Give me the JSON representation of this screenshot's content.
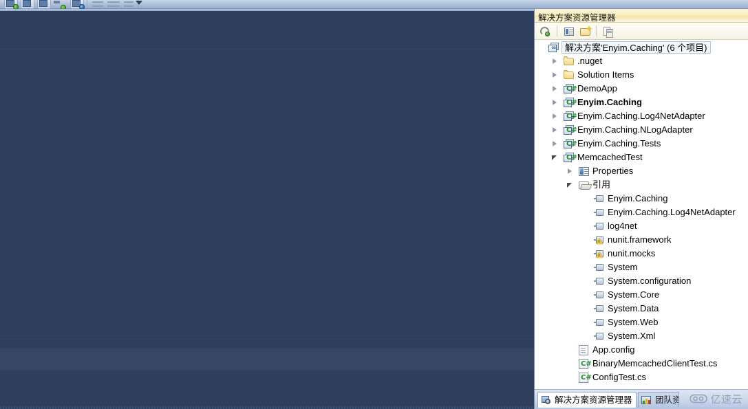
{
  "window": {
    "panel_title": "解决方案资源管理器"
  },
  "vs_toolbar": {
    "buttons": [
      {
        "name": "navigate-backward-button",
        "glyph": "back-arrow-icon"
      },
      {
        "name": "properties-window-button",
        "glyph": "properties-icon"
      },
      {
        "name": "object-browser-button",
        "glyph": "object-browser-icon"
      },
      {
        "name": "navigate-forward-button",
        "glyph": "forward-arrow-icon"
      },
      {
        "name": "toolbox-button",
        "glyph": "toolbox-icon"
      }
    ],
    "overflow_label": "▾"
  },
  "panel_toolbar": {
    "buttons": [
      {
        "name": "refresh-button",
        "icon": "refresh-icon",
        "tooltip": "刷新"
      },
      {
        "name": "properties-button",
        "icon": "properties-icon",
        "tooltip": "属性"
      },
      {
        "name": "show-all-files-button",
        "icon": "show-all-files-icon",
        "tooltip": "显示所有文件"
      },
      {
        "name": "copy-button",
        "icon": "copy-icon",
        "tooltip": "复制"
      }
    ]
  },
  "tree": {
    "nodes": [
      {
        "id": "solution-root",
        "label": "解决方案'Enyim.Caching' (6 个项目)",
        "icon": "solution-icon",
        "indent": 0,
        "twisty": "none",
        "selected": true,
        "bold": false
      },
      {
        "id": "nuget-folder",
        "label": ".nuget",
        "icon": "folder-icon",
        "indent": 1,
        "twisty": "collapsed",
        "selected": false,
        "bold": false
      },
      {
        "id": "solution-items-folder",
        "label": "Solution Items",
        "icon": "folder-icon",
        "indent": 1,
        "twisty": "collapsed",
        "selected": false,
        "bold": false
      },
      {
        "id": "project-demoapp",
        "label": "DemoApp",
        "icon": "csharp-project-icon",
        "indent": 1,
        "twisty": "collapsed",
        "selected": false,
        "bold": false
      },
      {
        "id": "project-enyim-caching",
        "label": "Enyim.Caching",
        "icon": "csharp-project-icon",
        "indent": 1,
        "twisty": "collapsed",
        "selected": false,
        "bold": true
      },
      {
        "id": "project-log4net-adapter",
        "label": "Enyim.Caching.Log4NetAdapter",
        "icon": "csharp-project-icon",
        "indent": 1,
        "twisty": "collapsed",
        "selected": false,
        "bold": false
      },
      {
        "id": "project-nlog-adapter",
        "label": "Enyim.Caching.NLogAdapter",
        "icon": "csharp-project-icon",
        "indent": 1,
        "twisty": "collapsed",
        "selected": false,
        "bold": false
      },
      {
        "id": "project-tests",
        "label": "Enyim.Caching.Tests",
        "icon": "csharp-project-icon",
        "indent": 1,
        "twisty": "collapsed",
        "selected": false,
        "bold": false
      },
      {
        "id": "project-memcachedtest",
        "label": "MemcachedTest",
        "icon": "csharp-project-icon",
        "indent": 1,
        "twisty": "expanded",
        "selected": false,
        "bold": false
      },
      {
        "id": "node-properties",
        "label": "Properties",
        "icon": "properties-node-icon",
        "indent": 2,
        "twisty": "collapsed",
        "selected": false,
        "bold": false
      },
      {
        "id": "node-references",
        "label": "引用",
        "icon": "open-folder-icon",
        "indent": 2,
        "twisty": "expanded",
        "selected": false,
        "bold": false
      },
      {
        "id": "ref-enyim-caching",
        "label": "Enyim.Caching",
        "icon": "reference-icon",
        "indent": 3,
        "twisty": "none",
        "selected": false,
        "bold": false
      },
      {
        "id": "ref-log4net-adapter",
        "label": "Enyim.Caching.Log4NetAdapter",
        "icon": "reference-icon",
        "indent": 3,
        "twisty": "none",
        "selected": false,
        "bold": false
      },
      {
        "id": "ref-log4net",
        "label": "log4net",
        "icon": "reference-icon",
        "indent": 3,
        "twisty": "none",
        "selected": false,
        "bold": false
      },
      {
        "id": "ref-nunit-framework",
        "label": "nunit.framework",
        "icon": "reference-warning-icon",
        "indent": 3,
        "twisty": "none",
        "selected": false,
        "bold": false
      },
      {
        "id": "ref-nunit-mocks",
        "label": "nunit.mocks",
        "icon": "reference-warning-icon",
        "indent": 3,
        "twisty": "none",
        "selected": false,
        "bold": false
      },
      {
        "id": "ref-system",
        "label": "System",
        "icon": "reference-icon",
        "indent": 3,
        "twisty": "none",
        "selected": false,
        "bold": false
      },
      {
        "id": "ref-system-configuration",
        "label": "System.configuration",
        "icon": "reference-icon",
        "indent": 3,
        "twisty": "none",
        "selected": false,
        "bold": false
      },
      {
        "id": "ref-system-core",
        "label": "System.Core",
        "icon": "reference-icon",
        "indent": 3,
        "twisty": "none",
        "selected": false,
        "bold": false
      },
      {
        "id": "ref-system-data",
        "label": "System.Data",
        "icon": "reference-icon",
        "indent": 3,
        "twisty": "none",
        "selected": false,
        "bold": false
      },
      {
        "id": "ref-system-web",
        "label": "System.Web",
        "icon": "reference-icon",
        "indent": 3,
        "twisty": "none",
        "selected": false,
        "bold": false
      },
      {
        "id": "ref-system-xml",
        "label": "System.Xml",
        "icon": "reference-icon",
        "indent": 3,
        "twisty": "none",
        "selected": false,
        "bold": false
      },
      {
        "id": "file-app-config",
        "label": "App.config",
        "icon": "config-file-icon",
        "indent": 2,
        "twisty": "none",
        "selected": false,
        "bold": false
      },
      {
        "id": "file-binary-memcached-client-test",
        "label": "BinaryMemcachedClientTest.cs",
        "icon": "csharp-file-icon",
        "indent": 2,
        "twisty": "none",
        "selected": false,
        "bold": false
      },
      {
        "id": "file-config-test",
        "label": "ConfigTest.cs",
        "icon": "csharp-file-icon",
        "indent": 2,
        "twisty": "none",
        "selected": false,
        "bold": false
      }
    ]
  },
  "panel_tabs": [
    {
      "id": "tab-solution-explorer",
      "label": "解决方案资源管理器",
      "icon": "solution-explorer-icon",
      "active": true
    },
    {
      "id": "tab-team-explorer",
      "label": "团队资",
      "icon": "team-explorer-icon",
      "active": false
    }
  ],
  "watermark": {
    "text": "亿速云",
    "logo": "cloud-logo-icon"
  },
  "colors": {
    "panel_title_bg": "#f8eec2",
    "editor_bg": "#2e3e5c",
    "selection_border": "#b5c4d6",
    "csharp_green": "#1f8b2e",
    "folder_yellow": "#f2d88a",
    "warning_yellow": "#f2c53a"
  }
}
